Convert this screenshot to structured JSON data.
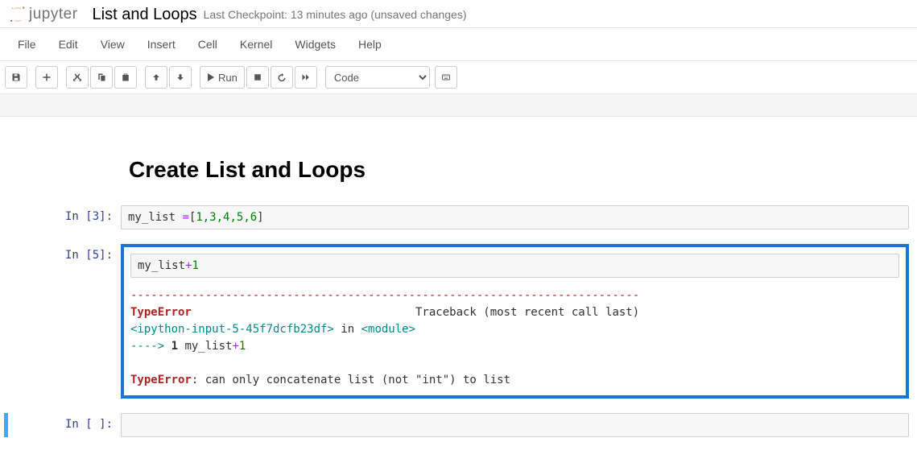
{
  "header": {
    "logo_text": "jupyter",
    "notebook_title": "List and Loops",
    "checkpoint": "Last Checkpoint: 13 minutes ago  (unsaved changes)"
  },
  "menubar": {
    "items": [
      "File",
      "Edit",
      "View",
      "Insert",
      "Cell",
      "Kernel",
      "Widgets",
      "Help"
    ]
  },
  "toolbar": {
    "run_label": "Run",
    "cell_type": "Code"
  },
  "notebook": {
    "heading": "Create List and Loops",
    "cells": [
      {
        "prompt_prefix": "In [",
        "prompt_num": "3",
        "prompt_suffix": "]:",
        "code_var": "my_list",
        "code_eq": " =",
        "code_brace_open": "[",
        "code_nums": "1,3,4,5,6",
        "code_brace_close": "]"
      },
      {
        "prompt_prefix": "In [",
        "prompt_num": "5",
        "prompt_suffix": "]:",
        "code_var": "my_list",
        "code_op": "+",
        "code_num": "1",
        "err_sep": "---------------------------------------------------------------------------",
        "err_name": "TypeError",
        "err_traceback": "                                 Traceback (most recent call last)",
        "err_file": "<ipython-input-5-45f7dcfb23df>",
        "err_in": " in ",
        "err_module": "<module>",
        "err_arrow": "----> ",
        "err_lineno": "1",
        "err_code": " my_list",
        "err_code_op": "+",
        "err_code_num": "1",
        "err_name2": "TypeError",
        "err_msg": ": can only concatenate list (not \"int\") to list"
      },
      {
        "prompt_prefix": "In [",
        "prompt_num": " ",
        "prompt_suffix": "]:"
      }
    ]
  }
}
